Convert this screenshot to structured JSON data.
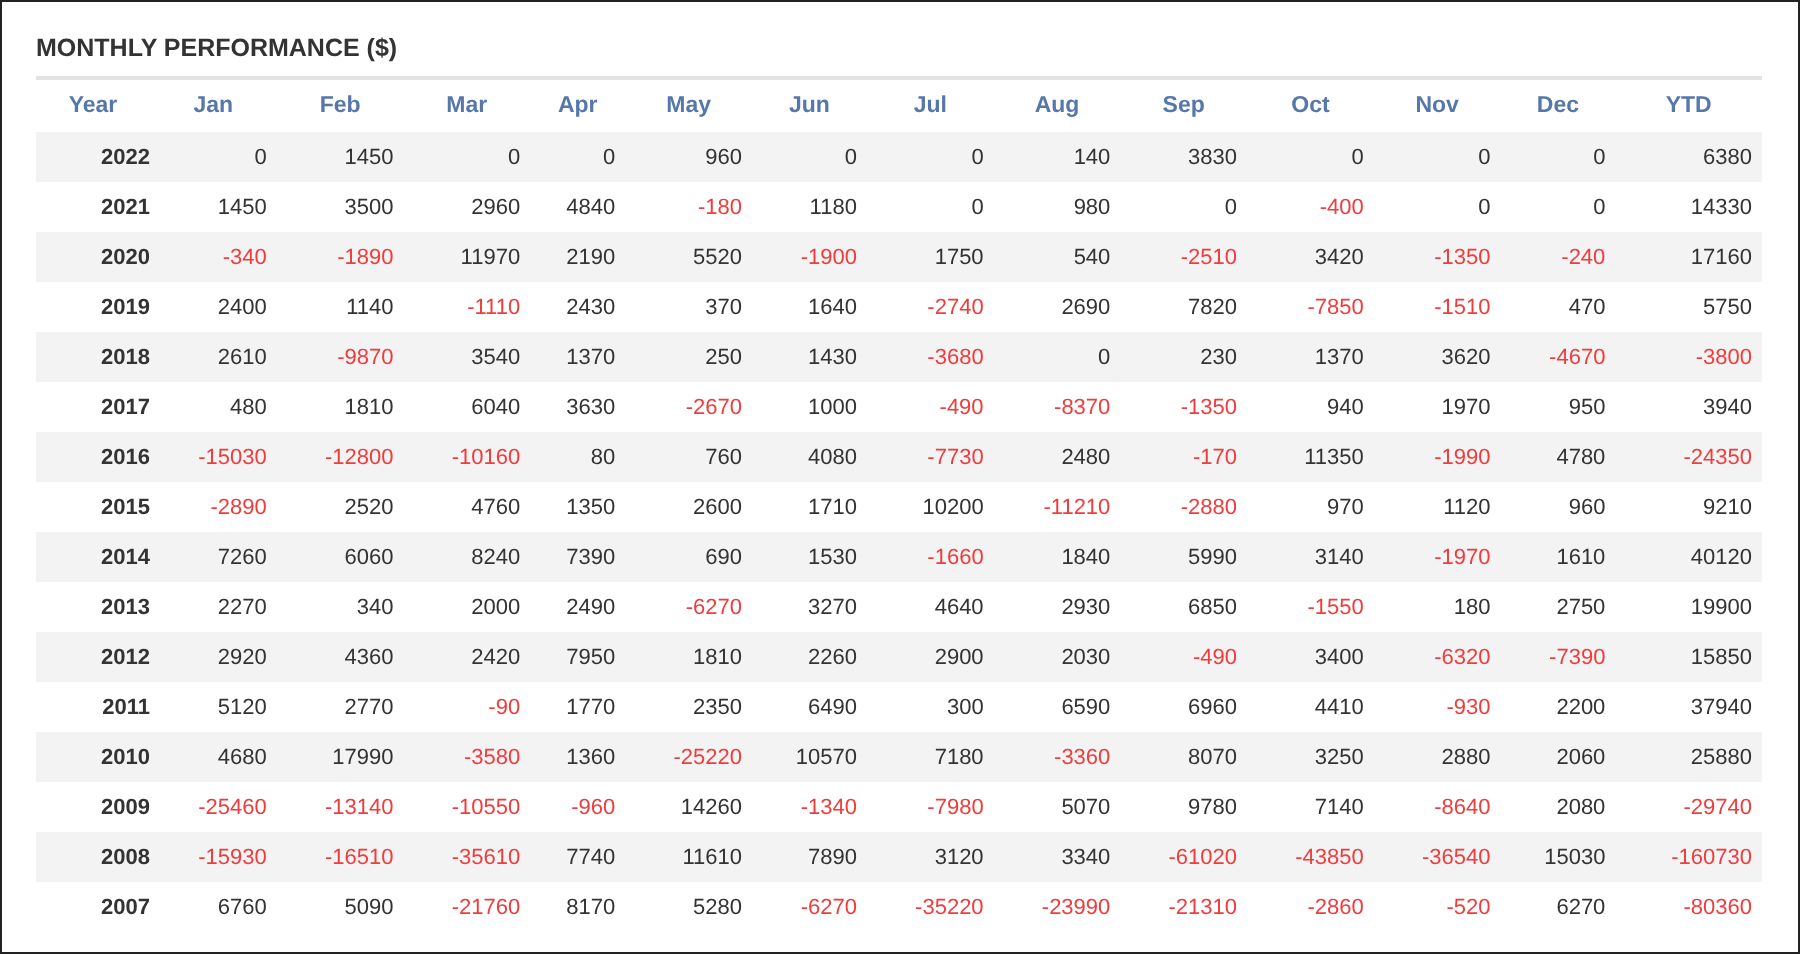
{
  "title": "MONTHLY PERFORMANCE ($)",
  "columns": [
    "Year",
    "Jan",
    "Feb",
    "Mar",
    "Apr",
    "May",
    "Jun",
    "Jul",
    "Aug",
    "Sep",
    "Oct",
    "Nov",
    "Dec",
    "YTD"
  ],
  "rows": [
    {
      "year": "2022",
      "values": [
        "0",
        "1450",
        "0",
        "0",
        "960",
        "0",
        "0",
        "140",
        "3830",
        "0",
        "0",
        "0",
        "6380"
      ]
    },
    {
      "year": "2021",
      "values": [
        "1450",
        "3500",
        "2960",
        "4840",
        "-180",
        "1180",
        "0",
        "980",
        "0",
        "-400",
        "0",
        "0",
        "14330"
      ]
    },
    {
      "year": "2020",
      "values": [
        "-340",
        "-1890",
        "11970",
        "2190",
        "5520",
        "-1900",
        "1750",
        "540",
        "-2510",
        "3420",
        "-1350",
        "-240",
        "17160"
      ]
    },
    {
      "year": "2019",
      "values": [
        "2400",
        "1140",
        "-1110",
        "2430",
        "370",
        "1640",
        "-2740",
        "2690",
        "7820",
        "-7850",
        "-1510",
        "470",
        "5750"
      ]
    },
    {
      "year": "2018",
      "values": [
        "2610",
        "-9870",
        "3540",
        "1370",
        "250",
        "1430",
        "-3680",
        "0",
        "230",
        "1370",
        "3620",
        "-4670",
        "-3800"
      ]
    },
    {
      "year": "2017",
      "values": [
        "480",
        "1810",
        "6040",
        "3630",
        "-2670",
        "1000",
        "-490",
        "-8370",
        "-1350",
        "940",
        "1970",
        "950",
        "3940"
      ]
    },
    {
      "year": "2016",
      "values": [
        "-15030",
        "-12800",
        "-10160",
        "80",
        "760",
        "4080",
        "-7730",
        "2480",
        "-170",
        "11350",
        "-1990",
        "4780",
        "-24350"
      ]
    },
    {
      "year": "2015",
      "values": [
        "-2890",
        "2520",
        "4760",
        "1350",
        "2600",
        "1710",
        "10200",
        "-11210",
        "-2880",
        "970",
        "1120",
        "960",
        "9210"
      ]
    },
    {
      "year": "2014",
      "values": [
        "7260",
        "6060",
        "8240",
        "7390",
        "690",
        "1530",
        "-1660",
        "1840",
        "5990",
        "3140",
        "-1970",
        "1610",
        "40120"
      ]
    },
    {
      "year": "2013",
      "values": [
        "2270",
        "340",
        "2000",
        "2490",
        "-6270",
        "3270",
        "4640",
        "2930",
        "6850",
        "-1550",
        "180",
        "2750",
        "19900"
      ]
    },
    {
      "year": "2012",
      "values": [
        "2920",
        "4360",
        "2420",
        "7950",
        "1810",
        "2260",
        "2900",
        "2030",
        "-490",
        "3400",
        "-6320",
        "-7390",
        "15850"
      ]
    },
    {
      "year": "2011",
      "values": [
        "5120",
        "2770",
        "-90",
        "1770",
        "2350",
        "6490",
        "300",
        "6590",
        "6960",
        "4410",
        "-930",
        "2200",
        "37940"
      ]
    },
    {
      "year": "2010",
      "values": [
        "4680",
        "17990",
        "-3580",
        "1360",
        "-25220",
        "10570",
        "7180",
        "-3360",
        "8070",
        "3250",
        "2880",
        "2060",
        "25880"
      ]
    },
    {
      "year": "2009",
      "values": [
        "-25460",
        "-13140",
        "-10550",
        "-960",
        "14260",
        "-1340",
        "-7980",
        "5070",
        "9780",
        "7140",
        "-8640",
        "2080",
        "-29740"
      ]
    },
    {
      "year": "2008",
      "values": [
        "-15930",
        "-16510",
        "-35610",
        "7740",
        "11610",
        "7890",
        "3120",
        "3340",
        "-61020",
        "-43850",
        "-36540",
        "15030",
        "-160730"
      ]
    },
    {
      "year": "2007",
      "values": [
        "6760",
        "5090",
        "-21760",
        "8170",
        "5280",
        "-6270",
        "-35220",
        "-23990",
        "-21310",
        "-2860",
        "-520",
        "6270",
        "-80360"
      ]
    }
  ]
}
